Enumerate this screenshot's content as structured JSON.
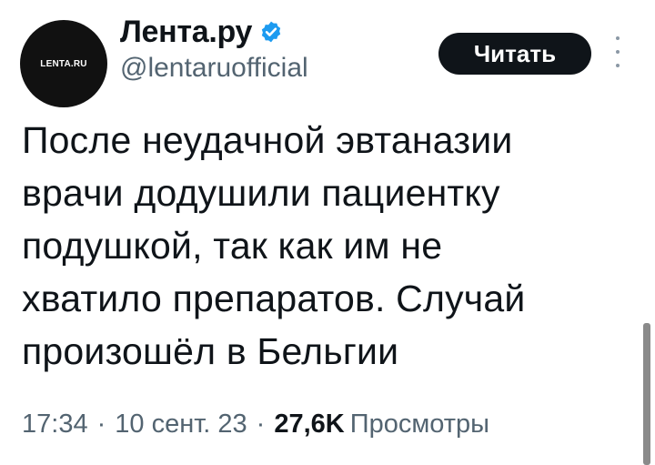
{
  "author": {
    "avatar_text": "LENTA.RU",
    "display_name": "Лента.ру",
    "handle": "@lentaruofficial",
    "verified_color": "#1d9bf0"
  },
  "actions": {
    "read_label": "Читать"
  },
  "tweet": {
    "text": "После неудачной эвтаназии\nврачи додушили пациентку\nподушкой, так как им не\nхватило препаратов. Случай\nпроизошёл в Бельгии"
  },
  "meta": {
    "time": "17:34",
    "date": "10 сент. 23",
    "separator": "·",
    "views_count": "27,6K",
    "views_label": "Просмотры"
  }
}
